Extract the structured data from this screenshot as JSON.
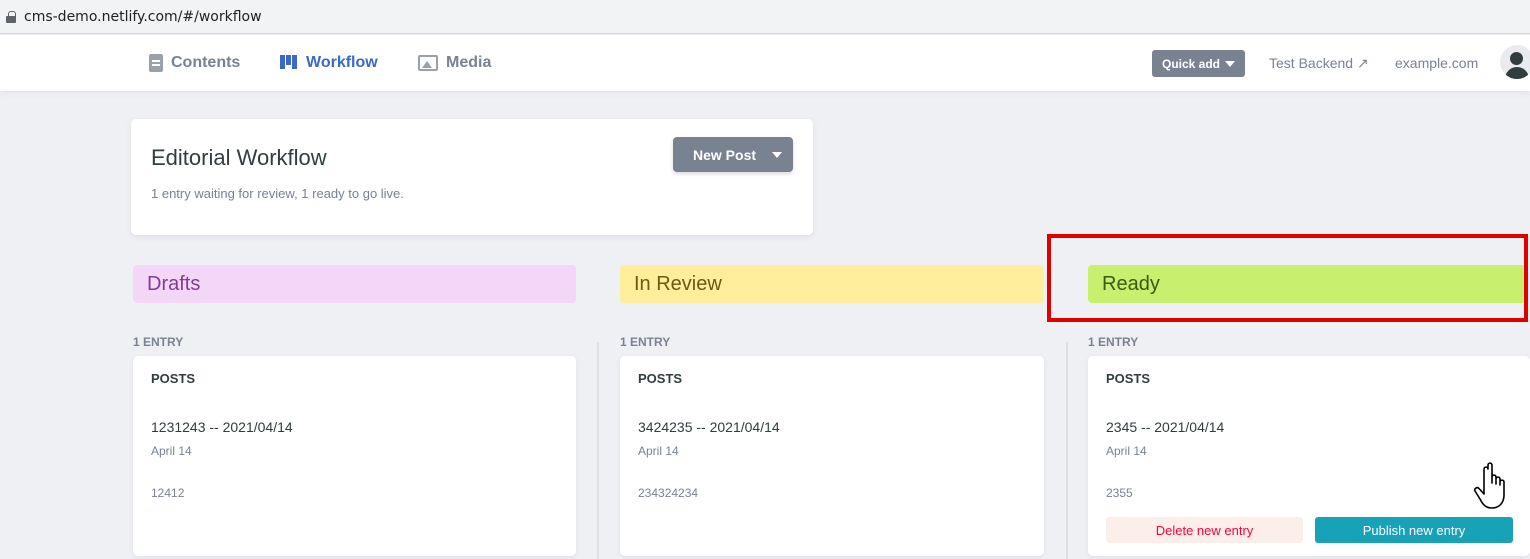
{
  "browser": {
    "url": "cms-demo.netlify.com/#/workflow"
  },
  "nav": {
    "contents": "Contents",
    "workflow": "Workflow",
    "media": "Media"
  },
  "header_actions": {
    "quick_add": "Quick add",
    "test_backend": "Test Backend ↗",
    "site": "example.com"
  },
  "overview": {
    "title": "Editorial Workflow",
    "summary": "1 entry waiting for review, 1 ready to go live.",
    "new_post": "New Post"
  },
  "columns": [
    {
      "name": "Drafts",
      "color": "#f4d6f9",
      "text_color": "#7e3f8f",
      "count": "1 ENTRY",
      "card": {
        "collection": "POSTS",
        "title": "1231243 -- 2021/04/14",
        "date": "April 14",
        "body": "12412"
      }
    },
    {
      "name": "In Review",
      "color": "#ffee9c",
      "text_color": "#6b5a10",
      "count": "1 ENTRY",
      "card": {
        "collection": "POSTS",
        "title": "3424235 -- 2021/04/14",
        "date": "April 14",
        "body": "234324234"
      }
    },
    {
      "name": "Ready",
      "color": "#c9ef6e",
      "text_color": "#3a5a12",
      "count": "1 ENTRY",
      "card": {
        "collection": "POSTS",
        "title": "2345 -- 2021/04/14",
        "date": "April 14",
        "body": "2355",
        "delete_label": "Delete new entry",
        "publish_label": "Publish new entry"
      }
    }
  ],
  "colors": {
    "accent": "#3a69c7",
    "publish": "#17a2b8",
    "delete": "#ff003b",
    "highlight": "#e00000"
  },
  "icons": [
    "lock-icon",
    "contents-icon",
    "workflow-icon",
    "media-icon",
    "caret-down-icon",
    "avatar-icon",
    "hand-cursor-icon"
  ]
}
